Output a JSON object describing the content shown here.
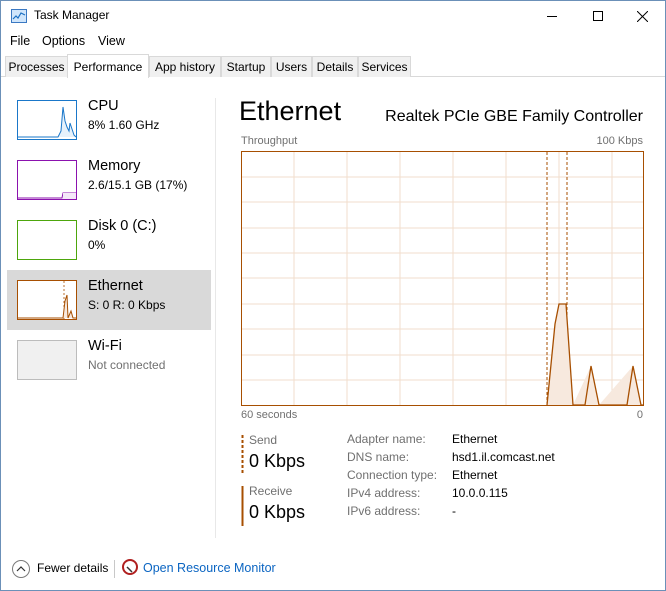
{
  "window": {
    "title": "Task Manager"
  },
  "menu": [
    "File",
    "Options",
    "View"
  ],
  "tabs": [
    "Processes",
    "Performance",
    "App history",
    "Startup",
    "Users",
    "Details",
    "Services"
  ],
  "sidebar": [
    {
      "title": "CPU",
      "sub": "8% 1.60 GHz",
      "color": "#1a77c9"
    },
    {
      "title": "Memory",
      "sub": "2.6/15.1 GB (17%)",
      "color": "#8b12ae"
    },
    {
      "title": "Disk 0 (C:)",
      "sub": "0%",
      "color": "#4da60c"
    },
    {
      "title": "Ethernet",
      "sub": "S: 0 R: 0 Kbps",
      "color": "#a74f01"
    },
    {
      "title": "Wi-Fi",
      "sub": "Not connected",
      "color": "#bcbcbc"
    }
  ],
  "header": {
    "title": "Ethernet",
    "subtitle": "Realtek PCIe GBE Family Controller"
  },
  "graph": {
    "top_left": "Throughput",
    "top_right": "100 Kbps",
    "bottom_left": "60 seconds",
    "bottom_right": "0",
    "color": "#a74f01"
  },
  "stats": {
    "send_label": "Send",
    "send_value": "0 Kbps",
    "receive_label": "Receive",
    "receive_value": "0 Kbps"
  },
  "info": [
    {
      "key": "Adapter name:",
      "value": "Ethernet"
    },
    {
      "key": "DNS name:",
      "value": "hsd1.il.comcast.net"
    },
    {
      "key": "Connection type:",
      "value": "Ethernet"
    },
    {
      "key": "IPv4 address:",
      "value": "10.0.0.115"
    },
    {
      "key": "IPv6 address:",
      "value": "-"
    }
  ],
  "footer": {
    "fewer": "Fewer details",
    "monitor": "Open Resource Monitor"
  }
}
